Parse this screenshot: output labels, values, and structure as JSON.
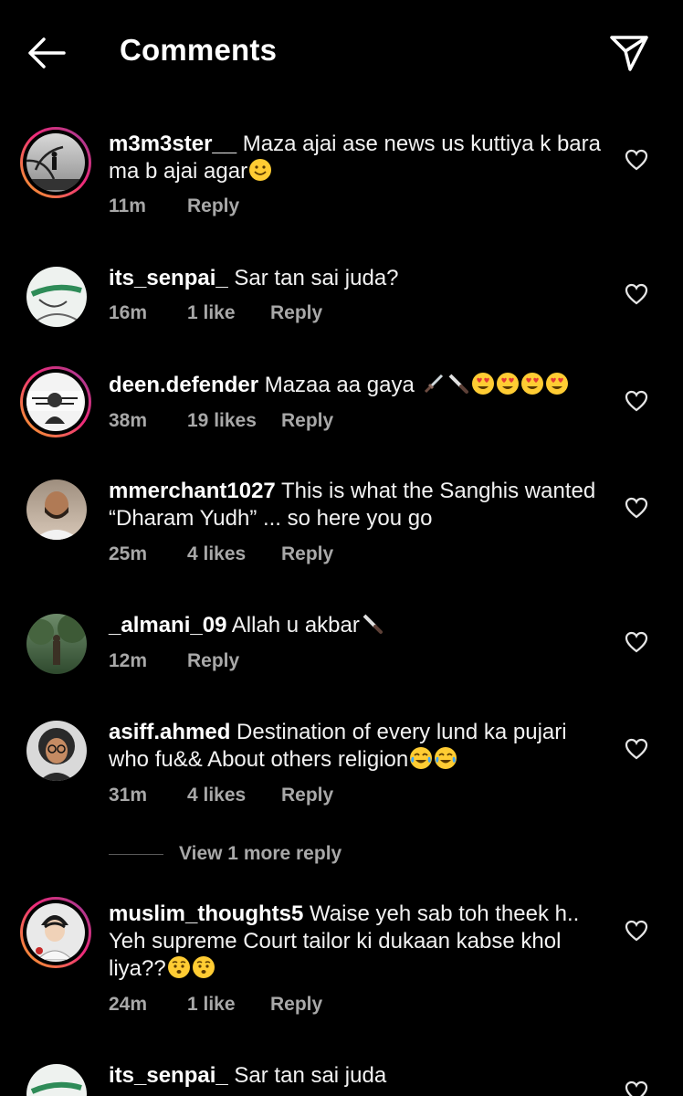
{
  "header": {
    "title": "Comments",
    "back_icon": "arrow-left-icon",
    "share_icon": "paper-plane-icon"
  },
  "comments": [
    {
      "username": "m3m3ster__",
      "text": "Maza ajai ase news us kuttiya k bara ma b ajai agar",
      "emojis": [
        "slightly-smiling-face"
      ],
      "time": "11m",
      "likes": "",
      "reply": "Reply"
    },
    {
      "username": "its_senpai_",
      "text": "Sar tan sai juda?",
      "emojis": [],
      "time": "16m",
      "likes": "1 like",
      "reply": "Reply"
    },
    {
      "username": "deen.defender",
      "text": "Mazaa aa gaya",
      "emojis": [
        "dagger",
        "knife",
        "heart-eyes",
        "heart-eyes",
        "heart-eyes",
        "heart-eyes"
      ],
      "time": "38m",
      "likes": "19 likes",
      "reply": "Reply"
    },
    {
      "username": "mmerchant1027",
      "text": "This is what the Sanghis wanted “Dharam Yudh” ... so here you go",
      "emojis": [],
      "time": "25m",
      "likes": "4 likes",
      "reply": "Reply"
    },
    {
      "username": "_almani_09",
      "text": "Allah u akbar",
      "emojis": [
        "knife"
      ],
      "time": "12m",
      "likes": "",
      "reply": "Reply"
    },
    {
      "username": "asiff.ahmed",
      "text": "Destination of every lund ka pujari who fu&& About others religion",
      "emojis": [
        "tears-of-joy",
        "tears-of-joy"
      ],
      "time": "31m",
      "likes": "4 likes",
      "reply": "Reply"
    },
    {
      "username": "muslim_thoughts5",
      "text": "Waise yeh sab toh theek h.. Yeh supreme Court tailor ki dukaan kabse khol liya??",
      "emojis": [
        "hushed-face",
        "hushed-face"
      ],
      "time": "24m",
      "likes": "1 like",
      "reply": "Reply"
    },
    {
      "username": "its_senpai_",
      "text": "Sar tan sai juda",
      "emojis": [],
      "time": "",
      "likes": "",
      "reply": ""
    }
  ],
  "view_more": "View 1 more reply",
  "icons": {
    "like": "heart-outline-icon"
  },
  "colors": {
    "background": "#000000",
    "meta_text": "#a8a8a8",
    "story_ring_start": "#f9a825",
    "story_ring_end": "#8a3ab9"
  }
}
